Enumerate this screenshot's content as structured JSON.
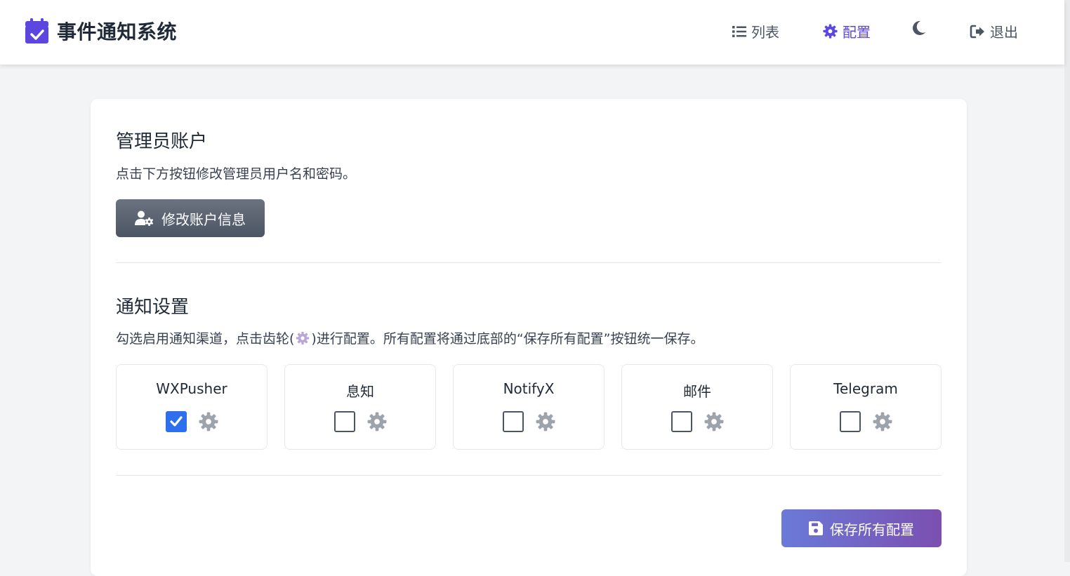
{
  "app": {
    "title": "事件通知系统",
    "icon": "calendar-check-icon",
    "brand_color": "#5b47e0"
  },
  "nav": {
    "items": [
      {
        "label": "列表",
        "icon": "list-icon",
        "active": false
      },
      {
        "label": "配置",
        "icon": "gear-icon",
        "active": true
      },
      {
        "label": "",
        "icon": "moon-icon",
        "active": false
      },
      {
        "label": "退出",
        "icon": "sign-out-icon",
        "active": false
      }
    ],
    "active_color": "#5b47e0"
  },
  "admin": {
    "title": "管理员账户",
    "description": "点击下方按钮修改管理员用户名和密码。",
    "button_label": "修改账户信息",
    "button_icon": "user-gear-icon"
  },
  "notify": {
    "title": "通知设置",
    "description_before": "勾选启用通知渠道，点击齿轮(",
    "description_after": ")进行配置。所有配置将通过底部的“保存所有配置”按钮统一保存。",
    "channels": [
      {
        "name": "WXPusher",
        "enabled": true
      },
      {
        "name": "息知",
        "enabled": false
      },
      {
        "name": "NotifyX",
        "enabled": false
      },
      {
        "name": "邮件",
        "enabled": false
      },
      {
        "name": "Telegram",
        "enabled": false
      }
    ],
    "checkbox_checked_color": "#2f6fed"
  },
  "footer": {
    "save_label": "保存所有配置",
    "save_icon": "floppy-disk-icon"
  }
}
